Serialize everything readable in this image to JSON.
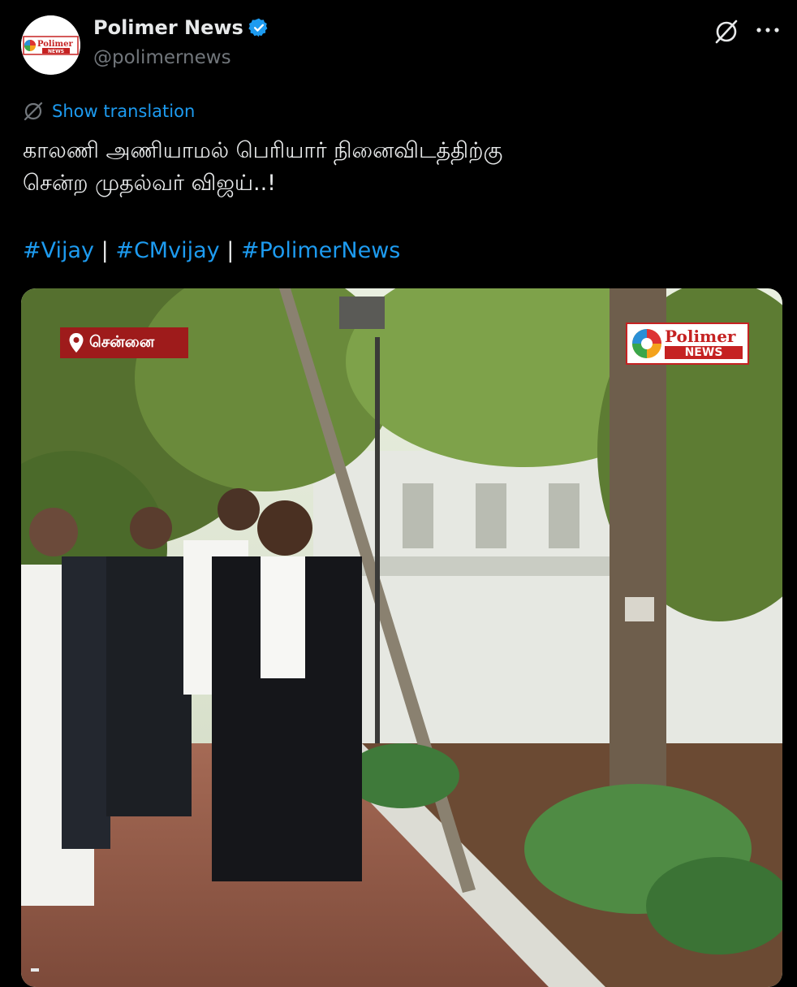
{
  "author": {
    "name": "Polimer News",
    "handle": "@polimernews",
    "avatar_brand": "Polimer",
    "avatar_brand_sub": "NEWS"
  },
  "icons": {
    "verified": "verified-badge-icon",
    "grok": "grok-icon",
    "more": "more-icon",
    "translate": "translate-icon"
  },
  "translate_label": "Show translation",
  "tweet": {
    "line1": "காலணி அணியாமல் பெரியார் நினைவிடத்திற்கு",
    "line2": "சென்ற முதல்வர் விஜய்..!",
    "hashtags": [
      "#Vijay",
      "#CMvijay",
      "#PolimerNews"
    ],
    "separator": "|"
  },
  "media": {
    "location_tag": "சென்னை",
    "brand_name": "Polimer",
    "brand_sub": "NEWS"
  },
  "colors": {
    "background": "#000000",
    "link": "#1d9bf0",
    "text": "#e7e9ea",
    "secondary": "#71767b",
    "brand_red": "#c52222",
    "location_red": "#9e1b1b"
  }
}
